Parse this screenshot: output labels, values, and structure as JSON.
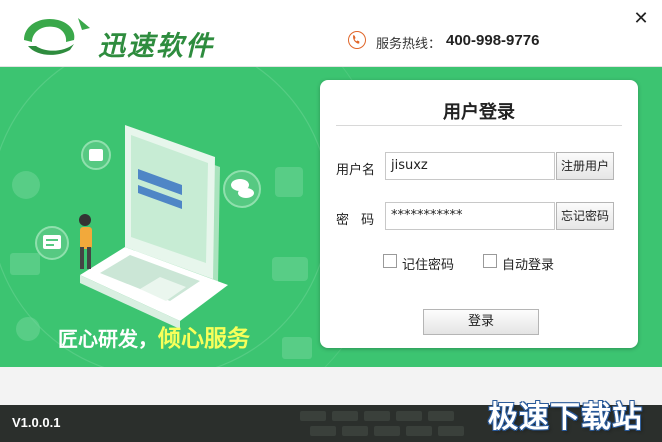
{
  "header": {
    "brand_name": "迅速软件",
    "hotline_label": "服务热线：",
    "hotline_number": "400-998-9776",
    "close_symbol": "✕"
  },
  "banner": {
    "slogan_plain": "匠心研发，",
    "slogan_highlight": "倾心服务"
  },
  "login": {
    "title": "用户登录",
    "username_label": "用户名",
    "username_value": "jisuxz",
    "register_button": "注册用户",
    "password_label": "密 码",
    "password_value": "***********",
    "forgot_button": "忘记密码",
    "remember_label": "记住密码",
    "remember_checked": false,
    "autologin_label": "自动登录",
    "autologin_checked": false,
    "submit_button": "登录"
  },
  "footer": {
    "version": "V1.0.0.1",
    "watermark": "极速下载站"
  },
  "colors": {
    "banner_green": "#3cc471",
    "brand_green": "#2e8c3e",
    "phone_orange": "#e0662a",
    "slogan_yellow": "#f7ff5a",
    "footer_dark": "#2b2f2c"
  },
  "icons": [
    "logo-mark",
    "phone-icon",
    "close-icon",
    "laptop-illustration",
    "checkbox-icon"
  ]
}
